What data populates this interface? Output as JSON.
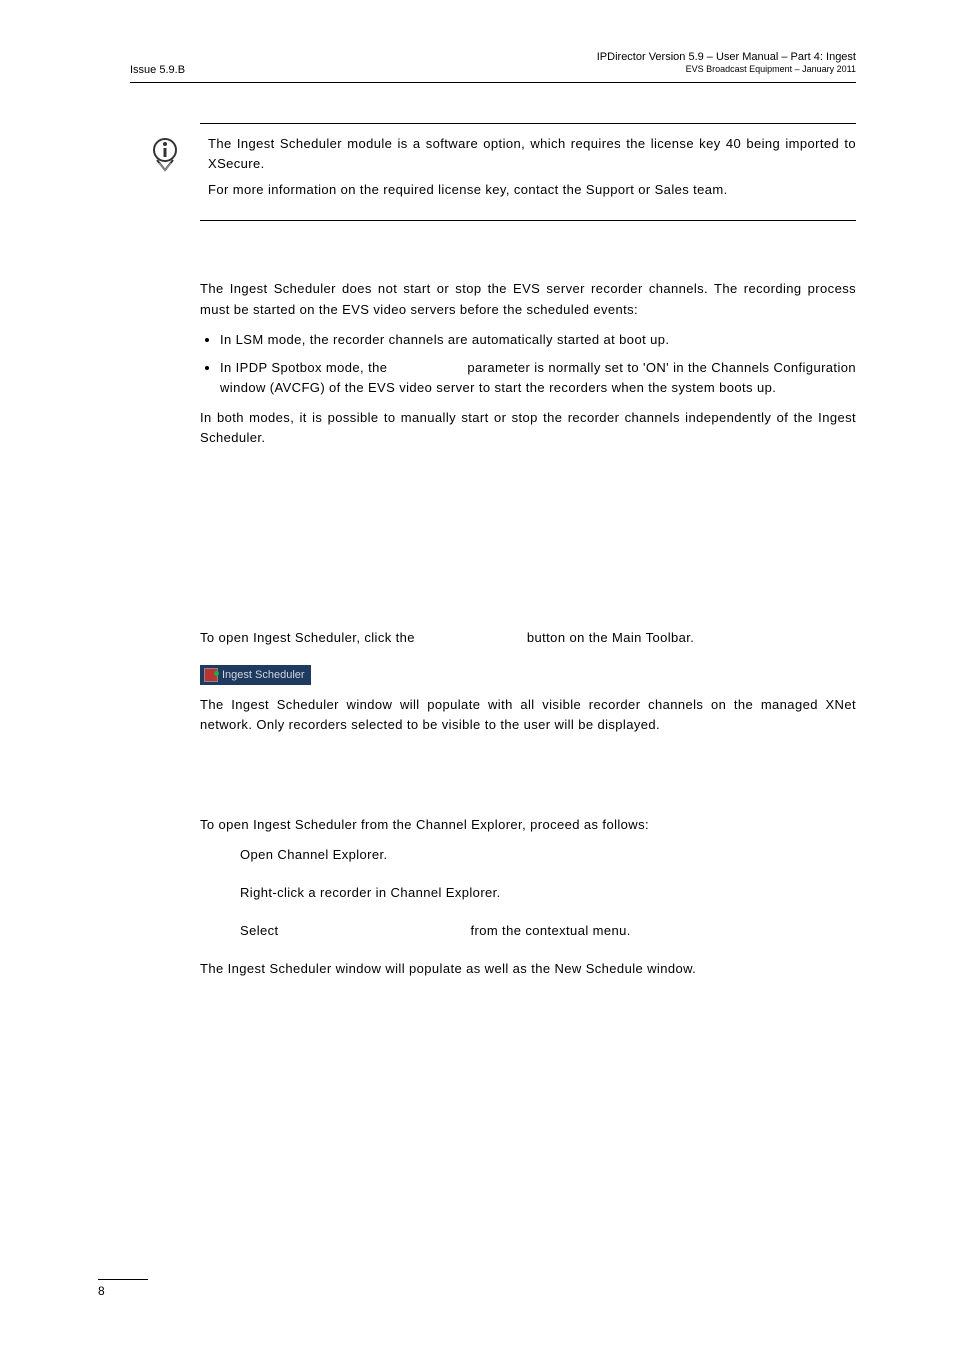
{
  "header": {
    "issue": "Issue 5.9.B",
    "title": "IPDirector Version 5.9 – User Manual – Part 4: Ingest",
    "subtitle": "EVS Broadcast Equipment – January 2011"
  },
  "note": {
    "p1": "The Ingest Scheduler module is a software option, which requires the license key 40 being imported to XSecure.",
    "p2": "For more information on the required license key, contact the Support or Sales team."
  },
  "body1": {
    "p1": "The Ingest Scheduler does not start or stop the EVS server recorder channels. The recording process must be started on the EVS video servers before the scheduled events:",
    "li1": "In LSM mode, the recorder channels are automatically started at boot up.",
    "li2_a": "In IPDP Spotbox mode, the ",
    "li2_b": " parameter is normally set to 'ON' in the Channels Configuration window (AVCFG) of the EVS video server to start the recorders when the system boots up.",
    "p2": "In both modes, it is possible to manually start or stop the recorder channels independently of the Ingest Scheduler."
  },
  "section1": {
    "p1_a": "To open Ingest Scheduler, click the ",
    "p1_b": " button on the Main Toolbar.",
    "button_label": "Ingest Scheduler",
    "p2": "The Ingest Scheduler window will populate with all visible recorder channels on the managed XNet network. Only recorders selected to be visible to the user will be displayed."
  },
  "section2": {
    "intro": "To open Ingest Scheduler from the Channel Explorer, proceed as follows:",
    "step1": "Open Channel Explorer.",
    "step2": "Right-click a recorder in Channel Explorer.",
    "step3_a": "Select ",
    "step3_b": " from the contextual menu.",
    "outro": "The Ingest Scheduler window will populate as well as the New Schedule window."
  },
  "page_number": "8"
}
